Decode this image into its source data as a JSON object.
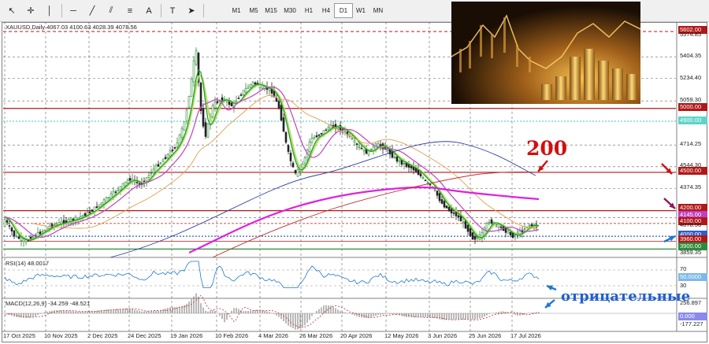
{
  "toolbar": {
    "tools": [
      {
        "name": "cursor-icon",
        "glyph": "↖"
      },
      {
        "name": "crosshair-icon",
        "glyph": "✛"
      },
      {
        "name": "vertical-line-icon",
        "glyph": "│"
      },
      {
        "name": "horizontal-line-icon",
        "glyph": "─"
      },
      {
        "name": "trendline-icon",
        "glyph": "╱"
      },
      {
        "name": "equidistant-channel-icon",
        "glyph": "⫽"
      },
      {
        "name": "fibonacci-icon",
        "glyph": "≡"
      },
      {
        "name": "text-label-icon",
        "glyph": "A"
      },
      {
        "name": "text-tool-icon",
        "glyph": "T"
      },
      {
        "name": "arrow-shapes-icon",
        "glyph": "➤"
      }
    ],
    "timeframes": [
      "M1",
      "M5",
      "M15",
      "M30",
      "H1",
      "H4",
      "D1",
      "W1",
      "MN"
    ],
    "active_timeframe": "D1"
  },
  "chart": {
    "header": "XAUUSD,Daily  4067.03 4100.63 4028.39 4078.56",
    "price_labels": [
      {
        "text": "5602.00",
        "tag": true,
        "bg": "#b01818"
      },
      {
        "text": "5574.85",
        "tag": false
      },
      {
        "text": "5404.35",
        "tag": false
      },
      {
        "text": "5234.40",
        "tag": false
      },
      {
        "text": "5059.30",
        "tag": false
      },
      {
        "text": "5000.00",
        "tag": true,
        "bg": "#b01818"
      },
      {
        "text": "4900.00",
        "tag": true,
        "bg": "#5fd4c8"
      },
      {
        "text": "4714.25",
        "tag": false
      },
      {
        "text": "4544.30",
        "tag": false
      },
      {
        "text": "4500.00",
        "tag": true,
        "bg": "#b01818"
      },
      {
        "text": "4374.35",
        "tag": false
      },
      {
        "text": "4200.00",
        "tag": true,
        "bg": "#b01818"
      },
      {
        "text": "4145.00",
        "tag": true,
        "bg": "#c040c0"
      },
      {
        "text": "4100.00",
        "tag": true,
        "bg": "#b01818"
      },
      {
        "text": "4078.56",
        "tag": false
      },
      {
        "text": "4000.00",
        "tag": true,
        "bg": "#2f5fc8"
      },
      {
        "text": "3960.00",
        "tag": true,
        "bg": "#b01818"
      },
      {
        "text": "3900.00",
        "tag": true,
        "bg": "#2f8a3a"
      },
      {
        "text": "3859.35",
        "tag": false
      }
    ],
    "x_labels": [
      "17 Oct 2025",
      "10 Nov 2025",
      "2 Dec 2025",
      "24 Dec 2025",
      "19 Jan 2026",
      "10 Feb 2026",
      "4 Mar 2026",
      "26 Mar 2026",
      "20 Apr 2026",
      "12 May 2026",
      "3 Jun 2026",
      "25 Jun 2026",
      "17 Jul 2026"
    ],
    "annotation_200": "200",
    "colors": {
      "up": "#2c8a34",
      "down": "#222222",
      "ma_fast": "#1a9a2a",
      "ma_mid": "#b0e060",
      "ma_slow": "#c050c0",
      "ma_100": "#e0a050",
      "ma_200": "#3040a0",
      "ma_pink": "#e020e0",
      "ma_red": "#c03030",
      "level_red": "#b01818"
    }
  },
  "rsi": {
    "title": "RSI(14) 48.0017",
    "label_70": "70",
    "label_30": "30",
    "value_tag": "50.0000"
  },
  "macd": {
    "title": "MACD(12,26,9) -34.259 -48.521",
    "top": "256.897",
    "zero": "0.000",
    "bottom": "-177.227"
  },
  "annotation_text": "отрицательные"
}
